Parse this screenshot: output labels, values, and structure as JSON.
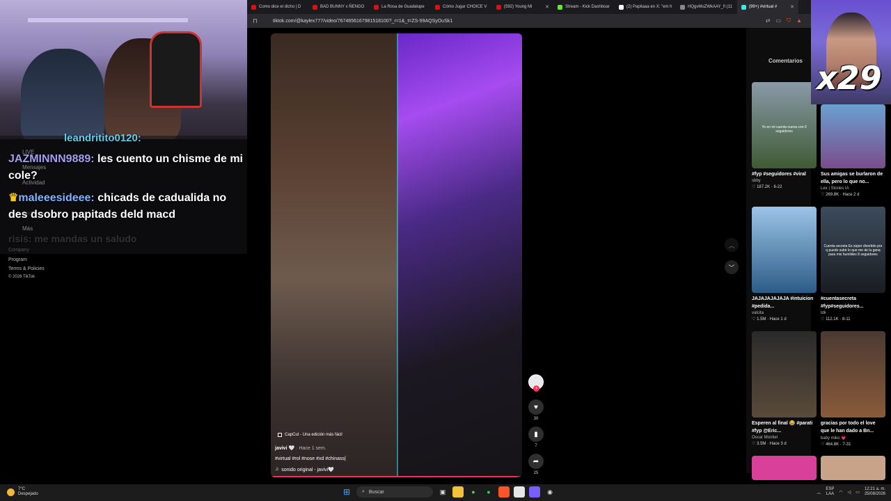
{
  "browser": {
    "tabs": [
      {
        "label": "Como dice el dicho | D",
        "color": "#ff0000"
      },
      {
        "label": "BAD BUNNY x ÑENGO",
        "color": "#ff0000"
      },
      {
        "label": "La Rosa de Guadalupe",
        "color": "#ff0000"
      },
      {
        "label": "Cómo Jugar CHOICE V",
        "color": "#ff0000"
      },
      {
        "label": "(592) Young Mi",
        "color": "#ff0000"
      },
      {
        "label": "Stream - Kick Dashboar",
        "color": "#53fc18"
      },
      {
        "label": "(2) Papitaaa en X: \"em h",
        "color": "#ffffff"
      },
      {
        "label": "HQgvMoZWkAAY_fl (11",
        "color": "#888888"
      },
      {
        "label": "(99+) #virtual #",
        "color": "#25f4ee"
      }
    ],
    "close_glyph": "✕",
    "url": "tiktok.com/@kaylex777/video/7674856167981518100?_r=1&_t=ZS-99AQSyOuSk1"
  },
  "chat": {
    "partial_user": "leandritito0120:",
    "messages": [
      {
        "user": "JAZMINNN9889:",
        "text": "les cuento un chisme de mi cole?"
      },
      {
        "user": "maleeesideee:",
        "text": "chicads de cadualida no des dsobro papitads deld macd"
      }
    ],
    "ghost_message": "risis: me mandas un saludo"
  },
  "tiktok_sidebar": {
    "items": [
      "LIVE",
      "Mensajes",
      "Actividad",
      "Perfil",
      "Más"
    ],
    "footer": [
      "Company",
      "Program",
      "Terms & Policies",
      "© 2026 TikTok"
    ]
  },
  "video": {
    "capcut": "CapCut - Una edición más fácil",
    "username": "javivi 🤍",
    "time_ago": "· Hace 1 sem.",
    "tags": "#virtual #rol #nose #xd #chinass|",
    "sound": "sonido original - javivi🤍",
    "progress": 0.98
  },
  "actions": {
    "likes": "30",
    "saves": "7",
    "shares": "25"
  },
  "overlay": {
    "multiplier": "x29"
  },
  "right_panel": {
    "header": "Comentarios",
    "cards": [
      {
        "title": "#fyp #seguidores #viral",
        "author": "sbby",
        "likes": "187.2K",
        "date": "6-22",
        "overlay": "Yo en mi cuenta nueva con 0 seguidores",
        "color1": "#8a9aa8",
        "color2": "#3f5a34"
      },
      {
        "title": "Sus amigas se burlaron de ella, pero lo que no...",
        "author": "Lex | Stories IA",
        "likes": "269.8K",
        "date": "Hace 2 d",
        "overlay": "",
        "color1": "#6aa0d0",
        "color2": "#7a4c8a"
      },
      {
        "title": "JAJAJAJAJAJA #intuicion #pedida...",
        "author": "valcita",
        "likes": "1.5M",
        "date": "Hace 1 d",
        "overlay": "",
        "color1": "#9dc4e8",
        "color2": "#2c5c86"
      },
      {
        "title": "#cuentasecreta #fyp#seguidores...",
        "author": "ldk",
        "likes": "112.1K",
        "date": "8-11",
        "overlay": "Cuenta secreta Es súper divertido por q puedo subir lo que me de la gana para mis humildes 8 seguidores",
        "color1": "#3c4c5c",
        "color2": "#1a1d22"
      },
      {
        "title": "Esperen al final 😂 #parati #fyp @Eric...",
        "author": "Oscar Montiel",
        "likes": "3.5M",
        "date": "Hace 3 d",
        "overlay": "",
        "color1": "#2a2a2a",
        "color2": "#5a4a3a"
      },
      {
        "title": "gracias por todo el love que le han dado a Bn...",
        "author": "baby miko 💗",
        "likes": "464.8K",
        "date": "7-31",
        "overlay": "",
        "color1": "#4a3a32",
        "color2": "#8a5a3a"
      }
    ],
    "next_thumbs": [
      {
        "color": "#d8409a"
      },
      {
        "color": "#c9a28a"
      }
    ]
  },
  "taskbar": {
    "temp": "7°C",
    "condition": "Despejado",
    "search": "Buscar",
    "lang_top": "ESP",
    "lang_bottom": "LAA",
    "time": "12:21 a. m.",
    "date": "25/08/2026"
  }
}
